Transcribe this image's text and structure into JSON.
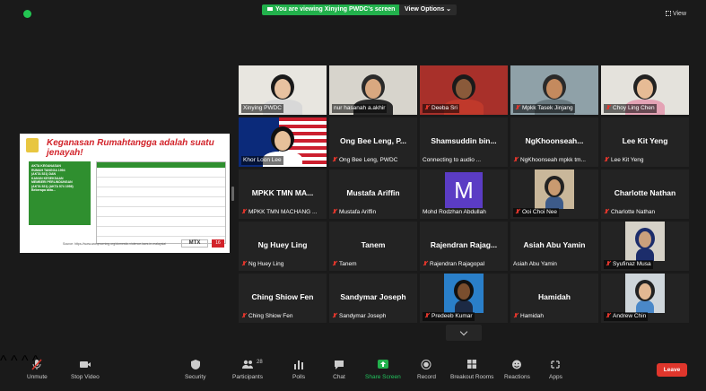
{
  "banner": {
    "text": "You are viewing Xinying PWDC's screen"
  },
  "view_options": {
    "label": "View Options ⌄"
  },
  "view_button": {
    "label": "View"
  },
  "shared_screen": {
    "title": "Keganasan Rumahtangga adalah suatu jenayah!",
    "sidebar_text": [
      "AKTA KEGANASAN",
      "RUMAH TANGGA 1994",
      "(AKTA 521) DAN",
      "KANUN KESEKSAAN",
      "MEMBERI PERLINDUNGAN",
      "(AKTA 521) (AKTA 574 1956)",
      "Beberapa akta..."
    ],
    "source": "Source: https://www.worqmorning.org/domestic-violence-laws-in-malaysia/",
    "brand": "MTX",
    "page": "16"
  },
  "tiles": [
    {
      "id": "xinying",
      "label": "Xinying PWDC",
      "big": "",
      "muted": false,
      "speaking": true
    },
    {
      "id": "nurhasanah",
      "label": "nur hasanah a.akhir",
      "big": "",
      "muted": false
    },
    {
      "id": "deeba",
      "label": "Deeba Sri",
      "big": "",
      "muted": true
    },
    {
      "id": "mpkk-tasek",
      "label": "Mpkk Tasek Jinjang",
      "big": "",
      "muted": true
    },
    {
      "id": "choy",
      "label": "Choy Ling Chen",
      "big": "",
      "muted": true
    },
    {
      "id": "loon",
      "label": "Khor Loon Lee",
      "big": "",
      "muted": false
    },
    {
      "id": "ongbee",
      "label": "Ong Bee Leng, PWDC",
      "big": "Ong Bee Leng, P...",
      "muted": true
    },
    {
      "id": "shamsuddin",
      "label": "Connecting to audio ...",
      "big": "Shamsuddin bin...",
      "muted": false
    },
    {
      "id": "ngkhoon",
      "label": "NgKhoonseah mpkk tm...",
      "big": "NgKhoonseah...",
      "muted": true
    },
    {
      "id": "leekit",
      "label": "Lee Kit Yeng",
      "big": "Lee Kit Yeng",
      "muted": true
    },
    {
      "id": "mpkk-tmn",
      "label": "MPKK TMN MACHANG ...",
      "big": "MPKK TMN MA...",
      "muted": true
    },
    {
      "id": "mustafa",
      "label": "Mustafa Ariffin",
      "big": "Mustafa Ariffin",
      "muted": true
    },
    {
      "id": "rodzhan",
      "label": "Mohd Rodzhan Abdullah",
      "big": "",
      "muted": false,
      "avatar": "M"
    },
    {
      "id": "ooi",
      "label": "Ooi Choi Nee",
      "big": "",
      "muted": true
    },
    {
      "id": "charlotte",
      "label": "Charlotte Nathan",
      "big": "Charlotte Nathan",
      "muted": true
    },
    {
      "id": "nghuey",
      "label": "Ng Huey Ling",
      "big": "Ng Huey Ling",
      "muted": true
    },
    {
      "id": "tanem",
      "label": "Tanem",
      "big": "Tanem",
      "muted": true
    },
    {
      "id": "rajendran",
      "label": "Rajendran Rajagopal",
      "big": "Rajendran Rajag...",
      "muted": true
    },
    {
      "id": "asiah",
      "label": "Asiah Abu Yamin",
      "big": "Asiah Abu Yamin",
      "muted": false
    },
    {
      "id": "syufinaz",
      "label": "Syufinaz Musa",
      "big": "",
      "muted": true
    },
    {
      "id": "ching",
      "label": "Ching Shiow Fen",
      "big": "Ching Shiow Fen",
      "muted": true
    },
    {
      "id": "sandymar",
      "label": "Sandymar Joseph",
      "big": "Sandymar Joseph",
      "muted": true
    },
    {
      "id": "predeeb",
      "label": "Predeeb Kumar",
      "big": "",
      "muted": true
    },
    {
      "id": "hamidah",
      "label": "Hamidah",
      "big": "Hamidah",
      "muted": true
    },
    {
      "id": "andrew",
      "label": "Andrew Chin",
      "big": "",
      "muted": true
    }
  ],
  "toolbar": {
    "unmute": "Unmute",
    "stop_video": "Stop Video",
    "security": "Security",
    "participants": "Participants",
    "participants_count": "28",
    "polls": "Polls",
    "chat": "Chat",
    "share_screen": "Share Screen",
    "record": "Record",
    "breakout": "Breakout Rooms",
    "reactions": "Reactions",
    "apps": "Apps",
    "leave": "Leave"
  },
  "colors": {
    "accent_green": "#22b14c",
    "leave_red": "#e0362c",
    "speaking_outline": "#b9e04a",
    "avatar_purple": "#5b3cc4"
  }
}
